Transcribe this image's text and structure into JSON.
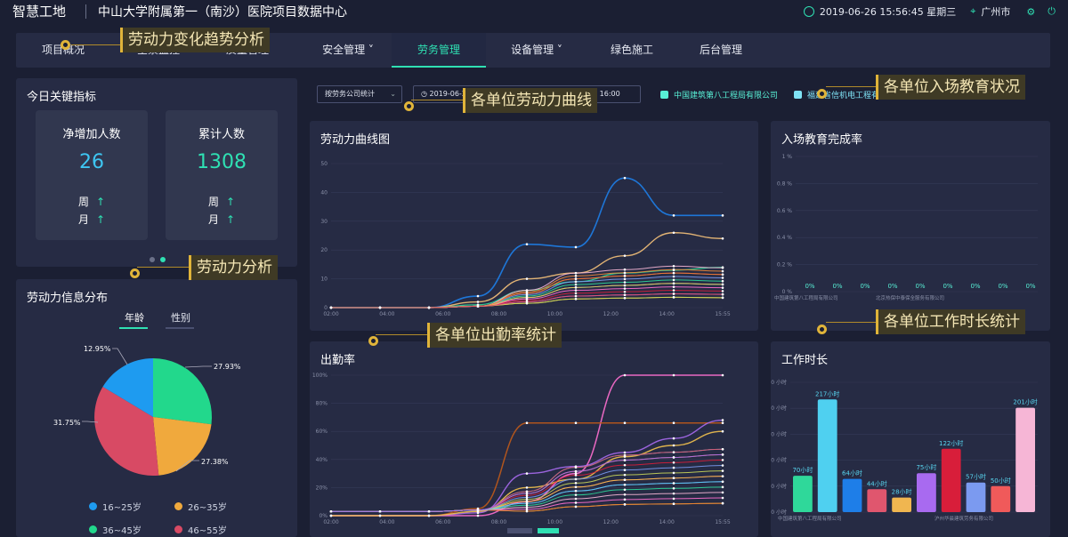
{
  "header": {
    "brand": "智慧工地",
    "title": "中山大学附属第一（南沙）医院项目数据中心",
    "datetime": "2019-06-26 15:56:45 星期三",
    "city": "广州市"
  },
  "nav": [
    {
      "label": "项目概况"
    },
    {
      "label": "全景监控"
    },
    {
      "label": "质量管理"
    },
    {
      "label": "安全管理 ˅"
    },
    {
      "label": "劳务管理",
      "active": true
    },
    {
      "label": "设备管理 ˅"
    },
    {
      "label": "绿色施工"
    },
    {
      "label": "后台管理"
    }
  ],
  "kpi": {
    "title": "今日关键指标",
    "cards": [
      {
        "label": "净增加人数",
        "value": "26",
        "week": "周",
        "month": "月",
        "color": "#3ec6f2"
      },
      {
        "label": "累计人数",
        "value": "1308",
        "week": "周",
        "month": "月",
        "color": "#2fe0b3"
      }
    ],
    "arrow": "↑"
  },
  "filter": {
    "select": "按劳务公司统计",
    "date": "2019-06-25 08:00",
    "date2": "2019-06-25 16:00"
  },
  "legend_top": [
    {
      "label": "中国建筑第八工程局有限公司",
      "color": "#58f0d6"
    },
    {
      "label": "福建省信机电工程有限",
      "color": "#7fe2f5"
    }
  ],
  "workforce_chart": {
    "title": "劳动力曲线图",
    "yticks": [
      "0",
      "10",
      "20",
      "30",
      "40",
      "50"
    ],
    "xticks": [
      "02:00",
      "04:00",
      "06:00",
      "08:00",
      "10:00",
      "12:00",
      "14:00",
      "15:55"
    ]
  },
  "attendance_chart": {
    "title": "出勤率",
    "yticks": [
      "0%",
      "20%",
      "40%",
      "60%",
      "80%",
      "100%"
    ],
    "xticks": [
      "02:00",
      "04:00",
      "06:00",
      "08:00",
      "10:00",
      "12:00",
      "14:00",
      "15:55"
    ]
  },
  "education": {
    "title": "入场教育完成率",
    "yticks": [
      "0 %",
      "0.2 %",
      "0.4 %",
      "0.6 %",
      "0.8 %",
      "1 %"
    ],
    "values": [
      "0%",
      "0%",
      "0%",
      "0%",
      "0%",
      "0%",
      "0%",
      "0%",
      "0%"
    ],
    "xlabels": [
      "中国建筑第八工程局有限公司",
      "北京热保中泰保全服务有限公司"
    ]
  },
  "distribution": {
    "title": "劳动力信息分布",
    "tabs": [
      "年龄",
      "性别"
    ],
    "pie_labels": [
      "27.93%",
      "27.38%",
      "31.75%",
      "12.95%"
    ],
    "legend": [
      {
        "label": "16~25岁",
        "color": "#1e9bf0"
      },
      {
        "label": "26~35岁",
        "color": "#f0a93d"
      },
      {
        "label": "36~45岁",
        "color": "#22d88c"
      },
      {
        "label": "46~55岁",
        "color": "#d84a64"
      }
    ]
  },
  "worktime": {
    "title": "工作时长",
    "yticks": [
      "0 小时",
      "50 小时",
      "100 小时",
      "150 小时",
      "200 小时",
      "250 小时"
    ],
    "bars": [
      {
        "v": 70,
        "label": "70小时",
        "color": "#2fd89a"
      },
      {
        "v": 217,
        "label": "217小时",
        "color": "#4fd0f0"
      },
      {
        "v": 64,
        "label": "64小时",
        "color": "#1e7ee8"
      },
      {
        "v": 44,
        "label": "44小时",
        "color": "#e0566e"
      },
      {
        "v": 28,
        "label": "28小时",
        "color": "#f0b650"
      },
      {
        "v": 75,
        "label": "75小时",
        "color": "#a86af0"
      },
      {
        "v": 122,
        "label": "122小时",
        "color": "#d81e3a"
      },
      {
        "v": 57,
        "label": "57小时",
        "color": "#7b9af0"
      },
      {
        "v": 50,
        "label": "50小时",
        "color": "#f05a5a"
      },
      {
        "v": 201,
        "label": "201小时",
        "color": "#f6b6d6"
      }
    ],
    "xlabels": [
      "中国建筑第八工程局有限公司",
      "沪州华晨建筑劳务有限公司"
    ]
  },
  "callouts": [
    "劳动力变化趋势分析",
    "各单位劳动力曲线",
    "各单位入场教育状况",
    "劳动力分析",
    "各单位出勤率统计",
    "各单位工作时长统计"
  ],
  "colors": {
    "accent": "#2fe0b3",
    "panel": "#262b44",
    "bg": "#1b1f33"
  }
}
